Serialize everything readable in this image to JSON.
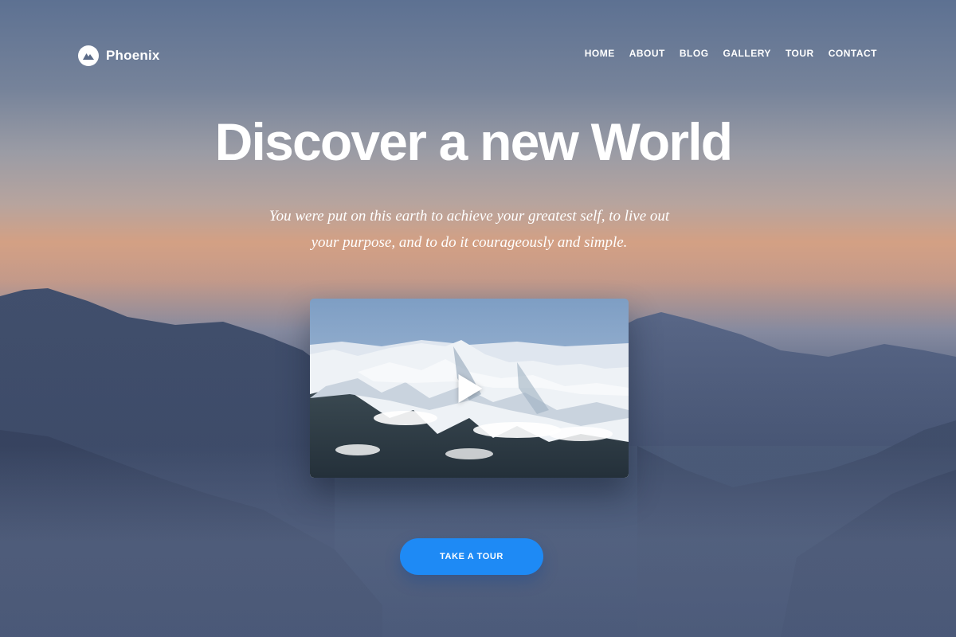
{
  "brand": {
    "name": "Phoenix",
    "logo_icon": "mountain-icon"
  },
  "nav": {
    "items": [
      {
        "label": "HOME"
      },
      {
        "label": "ABOUT"
      },
      {
        "label": "BLOG"
      },
      {
        "label": "GALLERY"
      },
      {
        "label": "TOUR"
      },
      {
        "label": "CONTACT"
      }
    ]
  },
  "hero": {
    "title": "Discover a new World",
    "subtitle_line1": "You were put on this earth to achieve your greatest self, to live out",
    "subtitle_line2": "your purpose, and to do it courageously and simple."
  },
  "video": {
    "thumbnail_icon": "snowy-mountains-image",
    "play_icon": "play-icon"
  },
  "cta": {
    "label": "TAKE A TOUR",
    "color": "#1e8af5"
  }
}
